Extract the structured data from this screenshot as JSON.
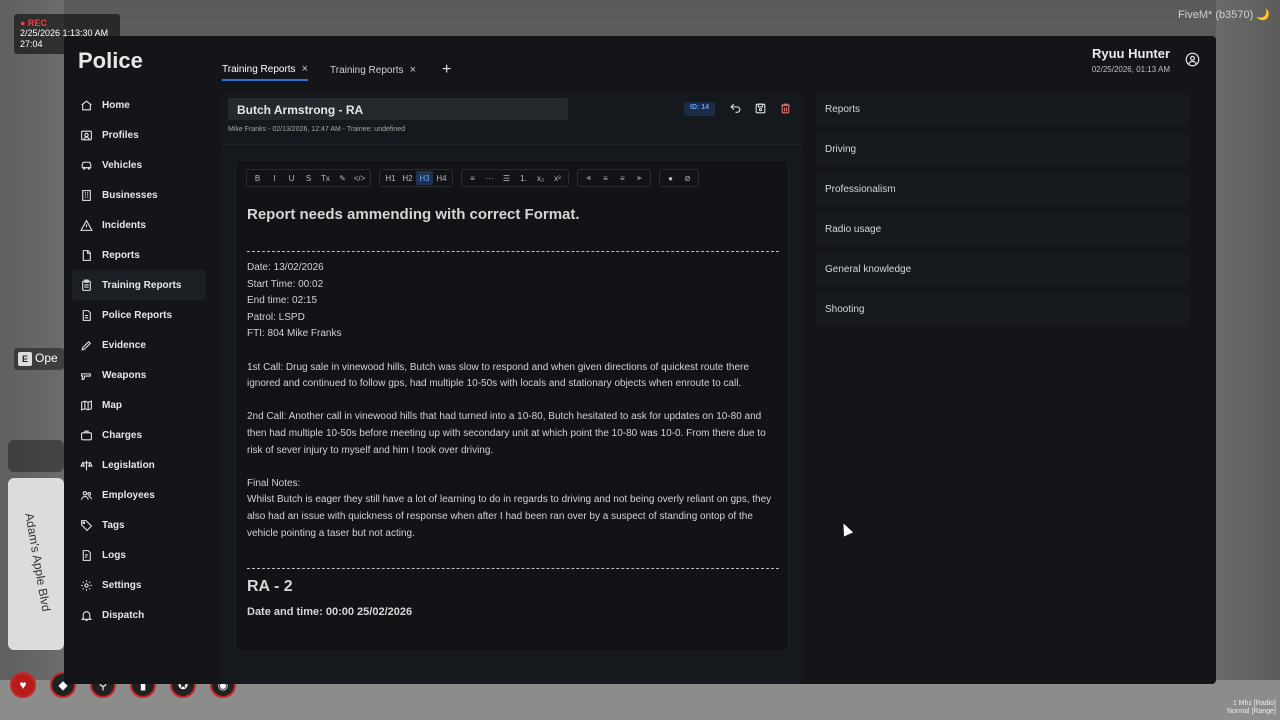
{
  "overlay": {
    "rec_label": "● REC",
    "rec_datetime": "2/25/2026 1:13:30 AM",
    "rec_duration": "27:04",
    "fivem_label": "FiveM* (b3570) 🌙",
    "radio_line1": "1 Mhz [Radio]",
    "radio_line2": "Normal [Range]",
    "ope_key": "E",
    "ope_text": "Ope",
    "minimap_street": "Adam's Apple Blvd"
  },
  "app": {
    "title": "Police",
    "user_name": "Ryuu Hunter",
    "user_date": "02/25/2026, 01:13 AM"
  },
  "nav": {
    "items": [
      {
        "label": "Home",
        "icon": "home-icon"
      },
      {
        "label": "Profiles",
        "icon": "user-icon"
      },
      {
        "label": "Vehicles",
        "icon": "car-icon"
      },
      {
        "label": "Businesses",
        "icon": "building-icon"
      },
      {
        "label": "Incidents",
        "icon": "alert-triangle-icon"
      },
      {
        "label": "Reports",
        "icon": "file-icon"
      },
      {
        "label": "Training Reports",
        "icon": "clipboard-icon"
      },
      {
        "label": "Police Reports",
        "icon": "file-text-icon"
      },
      {
        "label": "Evidence",
        "icon": "pen-icon"
      },
      {
        "label": "Weapons",
        "icon": "weapon-icon"
      },
      {
        "label": "Map",
        "icon": "map-icon"
      },
      {
        "label": "Charges",
        "icon": "briefcase-icon"
      },
      {
        "label": "Legislation",
        "icon": "scale-icon"
      },
      {
        "label": "Employees",
        "icon": "users-icon"
      },
      {
        "label": "Tags",
        "icon": "tag-icon"
      },
      {
        "label": "Logs",
        "icon": "log-icon"
      },
      {
        "label": "Settings",
        "icon": "gear-icon"
      },
      {
        "label": "Dispatch",
        "icon": "bell-icon"
      }
    ],
    "active": "Training Reports"
  },
  "tabs": [
    {
      "label": "Training Reports",
      "active": true
    },
    {
      "label": "Training Reports",
      "active": false
    }
  ],
  "report": {
    "title": "Butch Armstrong - RA",
    "meta": "Mike Franks - 02/13/2026, 12:47 AM - Trainee: undefined",
    "id_badge": "ID: 14"
  },
  "editor": {
    "toolbar": {
      "format": [
        "B",
        "I",
        "U",
        "S",
        "Tx",
        "✎",
        "</>"
      ],
      "headings": [
        "H1",
        "H2",
        "H3",
        "H4"
      ],
      "lists": [
        "≡",
        "···",
        "☰",
        "1.",
        "x₂",
        "x²"
      ],
      "align": [
        "⫷",
        "≡",
        "≡",
        "⫸"
      ],
      "extra": [
        "●",
        "⊘"
      ]
    },
    "heading": "Report needs ammending with correct Format.",
    "lines": {
      "date": "Date: 13/02/2026",
      "start": "Start Time: 00:02",
      "end": "End time: 02:15",
      "patrol": "Patrol: LSPD",
      "fti": "FTI: 804 Mike Franks"
    },
    "call1": "1st Call: Drug sale in vinewood hills, Butch was slow to respond and when given directions of quickest route there ignored and continued to follow gps, had multiple 10-50s with locals and stationary objects when enroute to call.",
    "call2": "2nd Call: Another call in vinewood hills that had turned into a 10-80, Butch hesitated to ask for updates on 10-80 and then had multiple 10-50s before meeting up with secondary unit at which point the 10-80 was 10-0. From there due to risk of sever injury to myself and him I took over driving.",
    "final_label": "Final Notes:",
    "final_text": "Whilst Butch is eager they still have a lot of learning to do in regards to driving and not being overly reliant on gps, they also had an issue with quickness of response when after I had been ran over by a suspect of standing ontop of the vehicle pointing a taser but not acting.",
    "section2_title": "RA - 2",
    "section2_date": "Date and time: 00:00 25/02/2026"
  },
  "categories": [
    "Reports",
    "Driving",
    "Professionalism",
    "Radio usage",
    "General knowledge",
    "Shooting"
  ]
}
